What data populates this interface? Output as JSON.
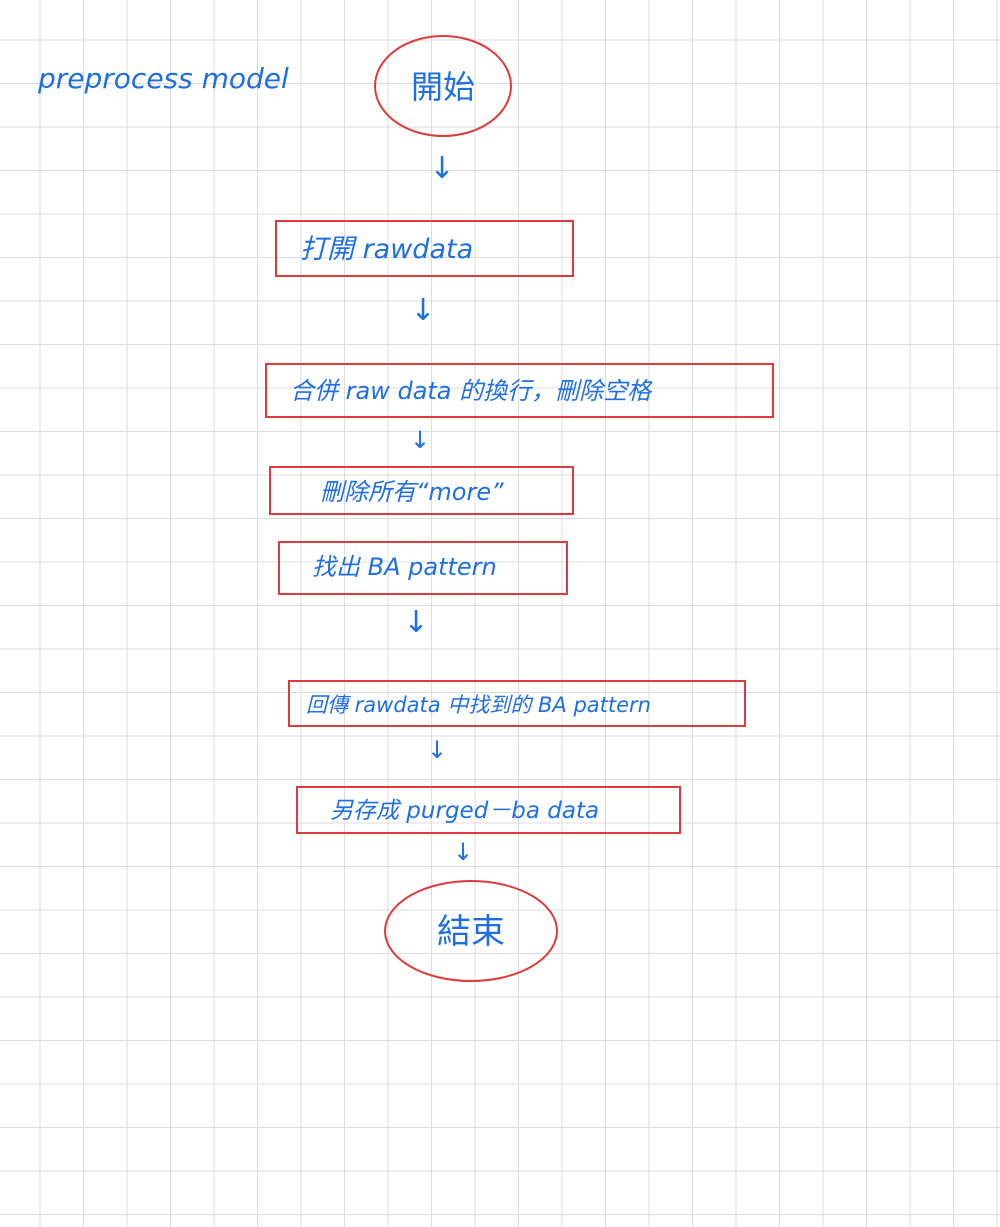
{
  "title": "preprocess model",
  "colors": {
    "box_stroke": "#de3c3c",
    "ink": "#1f6fe0",
    "grid": "#dcdcdc"
  },
  "nodes": {
    "start": "開始",
    "open_rawdata": "打開 rawdata",
    "merge_lines": "合併 raw data 的換行，刪除空格",
    "delete_more": "刪除所有“more”",
    "find_pattern": "找出 BA pattern",
    "return_pattern": "回傳 rawdata 中找到的 BA pattern",
    "save_as": "另存成 purged－ba data",
    "end": "結束"
  },
  "arrow_glyph": "↓"
}
